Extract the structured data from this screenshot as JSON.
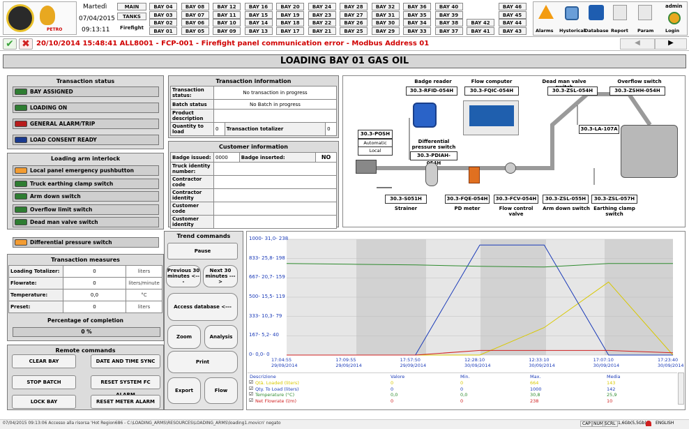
{
  "header": {
    "day": "Martedì",
    "date": "07/04/2015",
    "time": "09:13:11",
    "user": "admin",
    "logo_text": "PETRO"
  },
  "bays": {
    "rows": [
      [
        "BAY 04",
        "BAY 08",
        "BAY 12",
        "BAY 16",
        "BAY 20",
        "BAY 24",
        "BAY 28",
        "BAY 32",
        "BAY 36",
        "BAY 40",
        "",
        "BAY 46"
      ],
      [
        "BAY 03",
        "BAY 07",
        "BAY 11",
        "BAY 15",
        "BAY 19",
        "BAY 23",
        "BAY 27",
        "BAY 31",
        "BAY 35",
        "BAY 39",
        "",
        "BAY 45"
      ],
      [
        "BAY 02",
        "BAY 06",
        "BAY 10",
        "BAY 14",
        "BAY 18",
        "BAY 22",
        "BAY 26",
        "BAY 30",
        "BAY 34",
        "BAY 38",
        "BAY 42",
        "BAY 44"
      ],
      [
        "BAY 01",
        "BAY 05",
        "BAY 09",
        "BAY 13",
        "BAY 17",
        "BAY 21",
        "BAY 25",
        "BAY 29",
        "BAY 33",
        "BAY 37",
        "BAY 41",
        "BAY 43"
      ]
    ],
    "main": "MAIN",
    "tanks": "TANKS",
    "firefight": "Firefight"
  },
  "toolbar": {
    "alarms": "Alarms",
    "historical": "Hystorical",
    "database": "Database",
    "report": "Report",
    "param": "Param",
    "login": "Login"
  },
  "alarm_msg": "20/10/2014 15:48:41 ALL8001 - FCP-001 - Firefight panel communication error - Modbus Address 01",
  "page_title": "LOADING BAY 01  GAS OIL",
  "transaction_status": {
    "title": "Transaction status",
    "items": [
      {
        "label": "BAY ASSIGNED",
        "color": "#2e7d32"
      },
      {
        "label": "LOADING ON",
        "color": "#2e7d32"
      },
      {
        "label": "GENERAL ALARM/TRIP",
        "color": "#b71c1c"
      },
      {
        "label": "LOAD CONSENT READY",
        "color": "#1a3a8f"
      }
    ]
  },
  "interlock": {
    "title": "Loading arm interlock",
    "items": [
      {
        "label": "Local panel emergency pushbutton",
        "color": "#f39c32"
      },
      {
        "label": "Truck earthing clamp switch",
        "color": "#2e7d32"
      },
      {
        "label": "Arm down switch",
        "color": "#2e7d32"
      },
      {
        "label": "Overflow limit switch",
        "color": "#2e7d32"
      },
      {
        "label": "Dead man valve switch",
        "color": "#2e7d32"
      }
    ],
    "diff": {
      "label": "Differential pressure switch",
      "color": "#f39c32"
    }
  },
  "measures": {
    "title": "Transaction measures",
    "rows": [
      {
        "label": "Loading Totalizer:",
        "value": "0",
        "unit": "liters"
      },
      {
        "label": "Flowrate:",
        "value": "0",
        "unit": "liters/minute"
      },
      {
        "label": "Temperature:",
        "value": "0,0",
        "unit": "°C"
      },
      {
        "label": "Preset:",
        "value": "0",
        "unit": "liters"
      }
    ],
    "pct_title": "Percentage of completion",
    "pct": "0 %"
  },
  "remote": {
    "title": "Remote commands",
    "clear": "CLEAR BAY",
    "sync": "DATE AND TIME SYNC",
    "stop": "STOP BATCH",
    "reset_fc": "RESET SYSTEM FC ALARM",
    "lock": "LOCK BAY",
    "reset_meter": "RESET METER ALARM"
  },
  "transaction_info": {
    "title": "Transaction information",
    "status_label": "Transaction status:",
    "status_value": "No transaction in progress",
    "batch_label": "Batch status",
    "batch_value": "No Batch in progress",
    "product_label": "Product description",
    "qty_label": "Quantity to load",
    "qty_value": "0",
    "tot_label": "Transaction totalizer",
    "tot_value": "0"
  },
  "customer_info": {
    "title": "Customer information",
    "badge_label": "Badge issued:",
    "badge_value": "0000",
    "inserted_label": "Badge inserted:",
    "inserted_value": "NO",
    "rows": [
      "Truck identity number:",
      "Contractor code",
      "Contractor identity",
      "Customer code",
      "Customer identity"
    ]
  },
  "diagram": {
    "badge_reader": "Badge reader",
    "flow_computer": "Flow computer",
    "deadman": "Dead man valve switch",
    "overflow": "Overflow switch",
    "tag_rfid": "30.3-RFID-054H",
    "tag_fqic": "30.3-FQIC-054H",
    "tag_zsl": "30.3-ZSL-054H",
    "tag_zshh": "30.3-ZSHH-054H",
    "tag_posh": "30.3-POSH",
    "auto": "Automatic",
    "local": "Local",
    "diff_label": "Differential pressure switch",
    "tag_pdiah": "30.3-PDIAH-054H",
    "tag_la": "30.3-LA-107A",
    "tag_s051h": "30.3-S051H",
    "strainer": "Strainer",
    "tag_fqe": "30.3-FQE-054H",
    "pd_meter": "PD meter",
    "tag_fcv": "30.3-FCV-054H",
    "fcv_label": "Flow control valve",
    "tag_zsl055": "30.3-ZSL-055H",
    "arm_down": "Arm down switch",
    "tag_zsl057": "30.3-ZSL-057H",
    "earthing": "Earthing clamp switch"
  },
  "trend": {
    "title": "Trend commands",
    "pause": "Pause",
    "prev": "Previous 30 minutes <---",
    "next": "Next 30 minutes --->",
    "access": "Access database <---",
    "zoom": "Zoom",
    "analysis": "Analysis",
    "print": "Print",
    "export": "Export",
    "flow": "Flow",
    "yaxis": [
      "1000- 31,0- 238",
      "833- 25,8- 198",
      "667- 20,7- 159",
      "500- 15,5- 119",
      "333- 10,3- 79",
      "167- 5,2- 40",
      "0- 0,0- 0"
    ],
    "xaxis": [
      [
        "17:04:55",
        "29/09/2014"
      ],
      [
        "17:09:55",
        "29/09/2014"
      ],
      [
        "17:57:50",
        "29/09/2014"
      ],
      [
        "12:28:10",
        "30/09/2014"
      ],
      [
        "12:33:10",
        "30/09/2014"
      ],
      [
        "17:07:10",
        "30/09/2014"
      ],
      [
        "17:23:40",
        "30/09/2014"
      ]
    ],
    "table_head": [
      "Descrizione",
      "Valore",
      "Min.",
      "Max.",
      "Media"
    ],
    "table_rows": [
      {
        "name": "Qtà. Loaded (liters)",
        "color": "#d8c800",
        "v": "0",
        "min": "0",
        "max": "664",
        "avg": "143"
      },
      {
        "name": "Qty. To Load (liters)",
        "color": "#1a3ab8",
        "v": "0",
        "min": "0",
        "max": "1000",
        "avg": "142"
      },
      {
        "name": "Temperature (°C)",
        "color": "#2e8b2e",
        "v": "0,0",
        "min": "0,0",
        "max": "30,8",
        "avg": "25,9"
      },
      {
        "name": "Net Flowrate (l/m)",
        "color": "#d02020",
        "v": "0",
        "min": "0",
        "max": "238",
        "avg": "10"
      }
    ]
  },
  "status_bar": {
    "text": "07/04/2015 09:13:06 Accesso alla risorsa 'Hot Region686 - C:\\LOADING_ARMS\\RESOURCES\\LOADING_ARMS\\loading1.movicn' negato",
    "cap": "CAP",
    "num": "NUM",
    "scrl": "SCRL",
    "mem": "1,6Gb(5,5Gb)",
    "lang": "ENGLISH"
  },
  "chart_data": {
    "type": "line",
    "x": [
      "17:04:55 29/09/2014",
      "17:09:55 29/09/2014",
      "17:57:50 29/09/2014",
      "12:28:10 30/09/2014",
      "12:33:10 30/09/2014",
      "17:07:10 30/09/2014",
      "17:23:40 30/09/2014"
    ],
    "series": [
      {
        "name": "Qtà. Loaded (liters)",
        "color": "#d8c800",
        "values": [
          0,
          0,
          0,
          0,
          250,
          664,
          0
        ]
      },
      {
        "name": "Qty. To Load (liters)",
        "color": "#1a3ab8",
        "values": [
          0,
          0,
          0,
          1000,
          1000,
          0,
          0
        ]
      },
      {
        "name": "Temperature (°C)",
        "color": "#2e8b2e",
        "values": [
          25.8,
          25.6,
          25.4,
          25.0,
          24.8,
          25.8,
          25.8
        ]
      },
      {
        "name": "Net Flowrate (l/m)",
        "color": "#d02020",
        "values": [
          0,
          0,
          0,
          10,
          10,
          10,
          5
        ]
      }
    ],
    "ylim": [
      0,
      1000
    ]
  }
}
